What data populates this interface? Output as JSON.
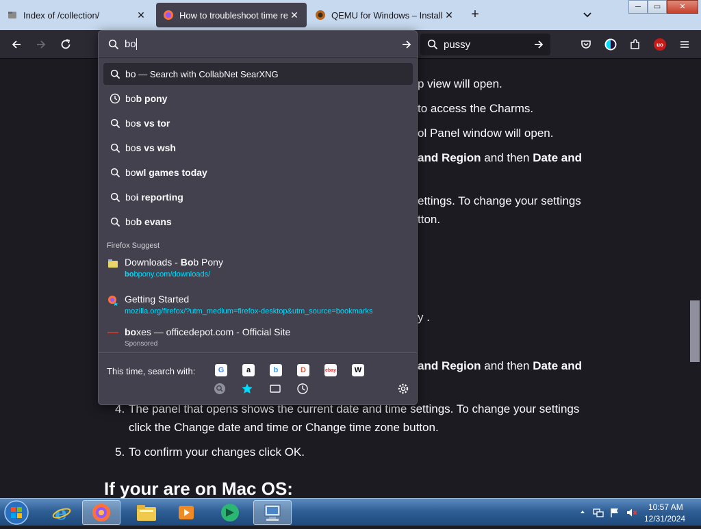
{
  "tabs": [
    {
      "title": "Index of /collection/",
      "close": "✕"
    },
    {
      "title": "How to troubleshoot time relat",
      "close": "✕"
    },
    {
      "title": "QEMU for Windows – Installers",
      "close": "✕"
    }
  ],
  "newtab": "+",
  "window_controls": {
    "min": "─",
    "max": "▭",
    "close": "✕"
  },
  "urlbar": {
    "typed": "bo"
  },
  "searchbar": {
    "text": "pussy"
  },
  "ubo_badge": "uo",
  "dropdown": {
    "heuristic": {
      "query": "bo",
      "dash": " — ",
      "action": "Search with CollabNet SearXNG"
    },
    "suggestions": [
      {
        "typed": "bo",
        "rest": "b pony",
        "icon": "clock-icon"
      },
      {
        "typed": "bo",
        "rest": "s vs tor",
        "icon": "search-icon"
      },
      {
        "typed": "bo",
        "rest": "s vs wsh",
        "icon": "search-icon"
      },
      {
        "typed": "bo",
        "rest": "wl games today",
        "icon": "search-icon"
      },
      {
        "typed": "bo",
        "rest": "i reporting",
        "icon": "search-icon"
      },
      {
        "typed": "bo",
        "rest": "b evans",
        "icon": "search-icon"
      }
    ],
    "suggest_header": "Firefox Suggest",
    "rich": [
      {
        "title_pre": "Downloads - ",
        "title_hl": "Bo",
        "title_post": "b Pony",
        "url_hl": "bo",
        "url_rest": "bpony.com/downloads/"
      },
      {
        "title_pre": "Getting Started",
        "title_hl": "",
        "title_post": "",
        "url_hl": "",
        "url_rest": "mozilla.org/firefox/?utm_medium=firefox-desktop&utm_source=bookmarks"
      },
      {
        "title_hl": "bo",
        "title_post": "xes — officedepot.com - Official Site",
        "sponsored": "Sponsored"
      }
    ],
    "one_time_label": "This time, search with:",
    "engines": [
      {
        "name": "google",
        "glyph": "G",
        "color": "#4285f4"
      },
      {
        "name": "amazon",
        "glyph": "a",
        "color": "#111111"
      },
      {
        "name": "bing",
        "glyph": "b",
        "color": "#2aa3ef"
      },
      {
        "name": "duckduckgo",
        "glyph": "D",
        "color": "#de5833"
      },
      {
        "name": "ebay",
        "glyph": "ebay",
        "color": "#e53238"
      },
      {
        "name": "wikipedia",
        "glyph": "W",
        "color": "#000000"
      }
    ]
  },
  "content": {
    "l1": "p view will open.",
    "l2": "to access the Charms.",
    "l3": "ol Panel window will open.",
    "l4_b1": "and Region",
    "l4_mid": " and then ",
    "l4_b2": "Date and",
    "l5": "ettings. To change your settings",
    "l6": "tton.",
    "l7": "y .",
    "l8_b1": "and Region",
    "l8_mid": " and then ",
    "l8_b2": "Date and",
    "item4_num": "4.",
    "item4_a": "The panel that opens shows the current date and time settings. To change your settings",
    "item4_b": "click the Change date and time or Change time zone button.",
    "item5_num": "5.",
    "item5": "To confirm your changes click OK.",
    "heading": "If your are on Mac OS:"
  },
  "taskbar": {
    "time": "10:57 AM",
    "date": "12/31/2024"
  },
  "colors": {
    "accent": "#00ddff",
    "panel": "#42414d",
    "page": "#1c1b22",
    "tabstrip": "#c6d9ee"
  }
}
